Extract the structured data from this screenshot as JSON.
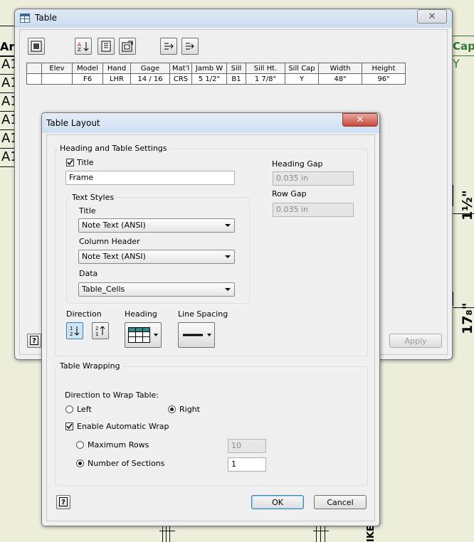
{
  "background": {
    "left_header": "Arch",
    "left_cells": [
      "A1",
      "A1",
      "A1",
      "A1",
      "A1",
      "A1"
    ],
    "right_header": "Cap",
    "right_value": "Y",
    "dim_top": "1½\"",
    "dim_bottom": "17₈\"",
    "bottom_text": "IKE"
  },
  "table_window": {
    "title": "Table",
    "close_icon": "close-icon",
    "toolbar_icons": [
      "table-props-icon",
      "sort-icon",
      "columns-icon",
      "format-icon",
      "export-icon",
      "import-icon"
    ],
    "grid": {
      "headers": [
        "",
        "Elev",
        "Model",
        "Hand",
        "Gage",
        "Mat'l",
        "Jamb W",
        "Sill",
        "Sill Ht.",
        "Sill Cap",
        "Width",
        "Height"
      ],
      "rows": [
        [
          "",
          "",
          "F6",
          "LHR",
          "14 / 16",
          "CRS",
          "5 1/2\"",
          "B1",
          "1 7/8\"",
          "Y",
          "48\"",
          "96\""
        ]
      ]
    },
    "apply_label": "Apply"
  },
  "layout_dialog": {
    "title": "Table Layout",
    "heading_group": "Heading and Table Settings",
    "title_label": "Title",
    "title_checked": true,
    "title_value": "Frame",
    "heading_gap_label": "Heading Gap",
    "heading_gap_value": "0.035 in",
    "row_gap_label": "Row Gap",
    "row_gap_value": "0.035 in",
    "text_styles_group": "Text Styles",
    "style_title_label": "Title",
    "style_title_value": "Note Text (ANSI)",
    "column_header_label": "Column Header",
    "column_header_value": "Note Text (ANSI)",
    "data_label": "Data",
    "data_value": "Table_Cells",
    "direction_label": "Direction",
    "heading_label": "Heading",
    "line_spacing_label": "Line Spacing",
    "wrapping_group": "Table Wrapping",
    "direction_wrap_label": "Direction to Wrap Table:",
    "left_label": "Left",
    "right_label": "Right",
    "wrap_direction": "Right",
    "auto_wrap_label": "Enable Automatic Wrap",
    "auto_wrap_checked": true,
    "max_rows_label": "Maximum Rows",
    "max_rows_value": "10",
    "sections_label": "Number of Sections",
    "sections_value": "1",
    "ok_label": "OK",
    "cancel_label": "Cancel"
  },
  "colors": {
    "accent": "#c9483a",
    "title_bar_blue": "#cbdcf0",
    "background_paper": "#eeeedd",
    "highlight_green": "#2f7a35"
  }
}
